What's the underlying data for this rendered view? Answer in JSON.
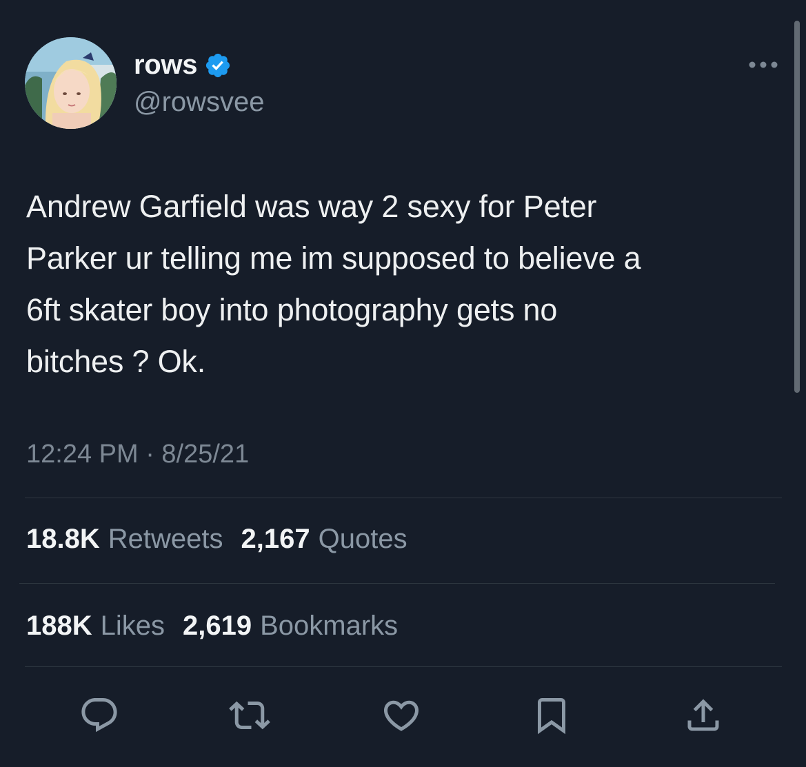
{
  "author": {
    "name": "rows",
    "handle": "@rowsvee",
    "verified_icon": "verified-badge-icon",
    "verified_color": "#1d9bf0"
  },
  "tweet": {
    "text": "Andrew Garfield was way 2 sexy for Peter\nParker ur telling me im supposed to believe a\n6ft skater boy into photography gets no\nbitches ? Ok.",
    "timestamp": "12:24 PM · 8/25/21"
  },
  "stats": {
    "retweets": {
      "count": "18.8K",
      "label": "Retweets"
    },
    "quotes": {
      "count": "2,167",
      "label": "Quotes"
    },
    "likes": {
      "count": "188K",
      "label": "Likes"
    },
    "bookmarks": {
      "count": "2,619",
      "label": "Bookmarks"
    }
  },
  "actions": [
    {
      "name": "reply",
      "icon": "reply-icon"
    },
    {
      "name": "retweet",
      "icon": "retweet-icon"
    },
    {
      "name": "like",
      "icon": "heart-icon"
    },
    {
      "name": "bookmark",
      "icon": "bookmark-icon"
    },
    {
      "name": "share",
      "icon": "share-icon"
    }
  ],
  "theme": {
    "background": "#161d29",
    "text": "#e7e9ea",
    "muted": "#8b98a5",
    "divider": "#2f3841"
  }
}
